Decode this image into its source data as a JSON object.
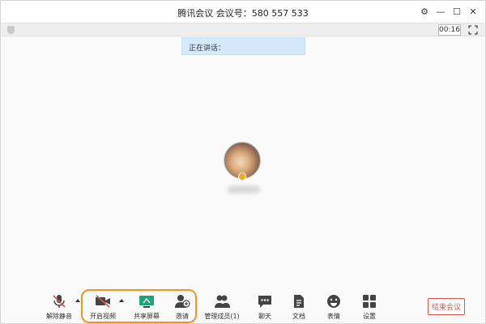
{
  "window": {
    "title": "腾讯会议 会议号：580 557 533",
    "controls": {
      "settings": "⚙",
      "minimize": "—",
      "maximize": "☐",
      "close": "✕"
    }
  },
  "infobar": {
    "timer": "00:16"
  },
  "speaking": {
    "label": "正在讲话："
  },
  "toolbar": {
    "unmute": "解除静音",
    "video": "开启视频",
    "share": "共享屏幕",
    "invite": "邀请",
    "members": "管理成员(1)",
    "chat": "聊天",
    "docs": "文档",
    "emoji": "表情",
    "settings": "设置",
    "end": "结束会议"
  },
  "icons": {
    "unmute": "microphone-muted-icon",
    "video": "camera-off-icon",
    "share": "screen-share-icon",
    "invite": "invite-user-icon",
    "members": "members-icon",
    "chat": "chat-icon",
    "docs": "document-icon",
    "emoji": "emoji-icon",
    "settings": "grid-settings-icon"
  },
  "colors": {
    "highlight": "#f39323",
    "end": "#e0534a",
    "share_green": "#1fa37a"
  }
}
